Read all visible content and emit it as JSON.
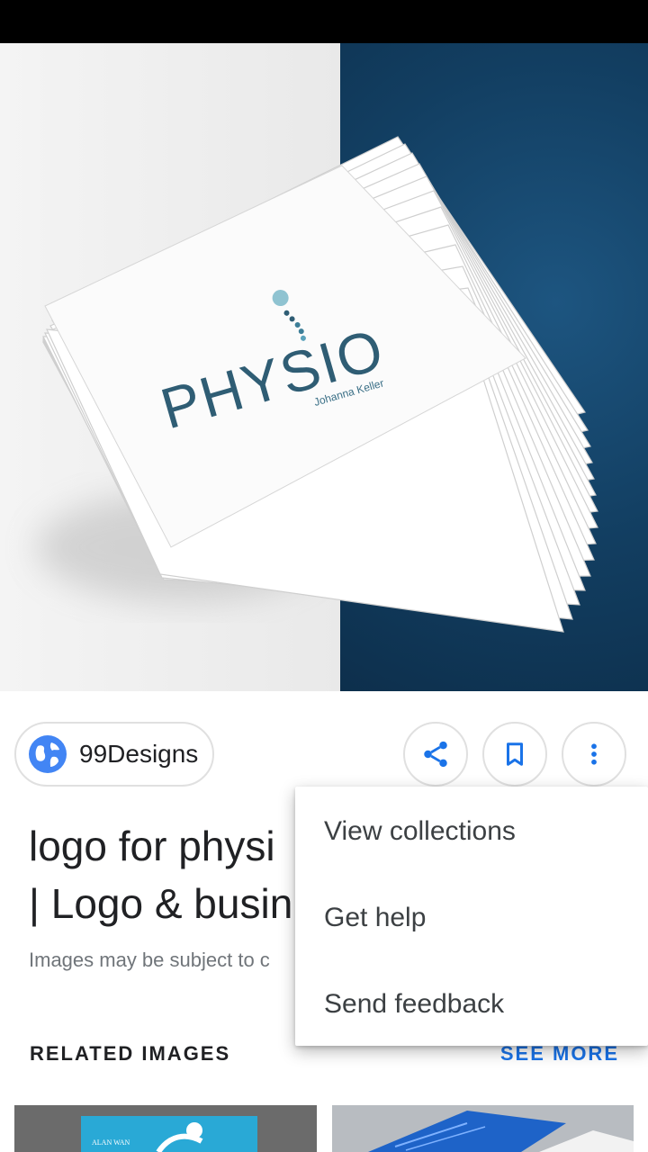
{
  "hero": {
    "card_wordmark": "PHYSIO",
    "card_name": "Johanna Keller"
  },
  "source": {
    "label": "99Designs",
    "icon": "globe-icon"
  },
  "actions": {
    "share_icon": "share-icon",
    "save_icon": "bookmark-icon",
    "more_icon": "more-vert-icon"
  },
  "result": {
    "title_line1": "logo for physi",
    "title_line2": "| Logo & busin",
    "notice": "Images may be subject to c"
  },
  "related": {
    "heading": "RELATED IMAGES",
    "see_more": "SEE MORE",
    "thumb1_text": "ALAN WAN"
  },
  "menu": {
    "items": [
      "View collections",
      "Get help",
      "Send feedback"
    ]
  },
  "colors": {
    "accent": "#1a73e8",
    "icon_blue": "#4285f4",
    "navy": "#123e61"
  }
}
